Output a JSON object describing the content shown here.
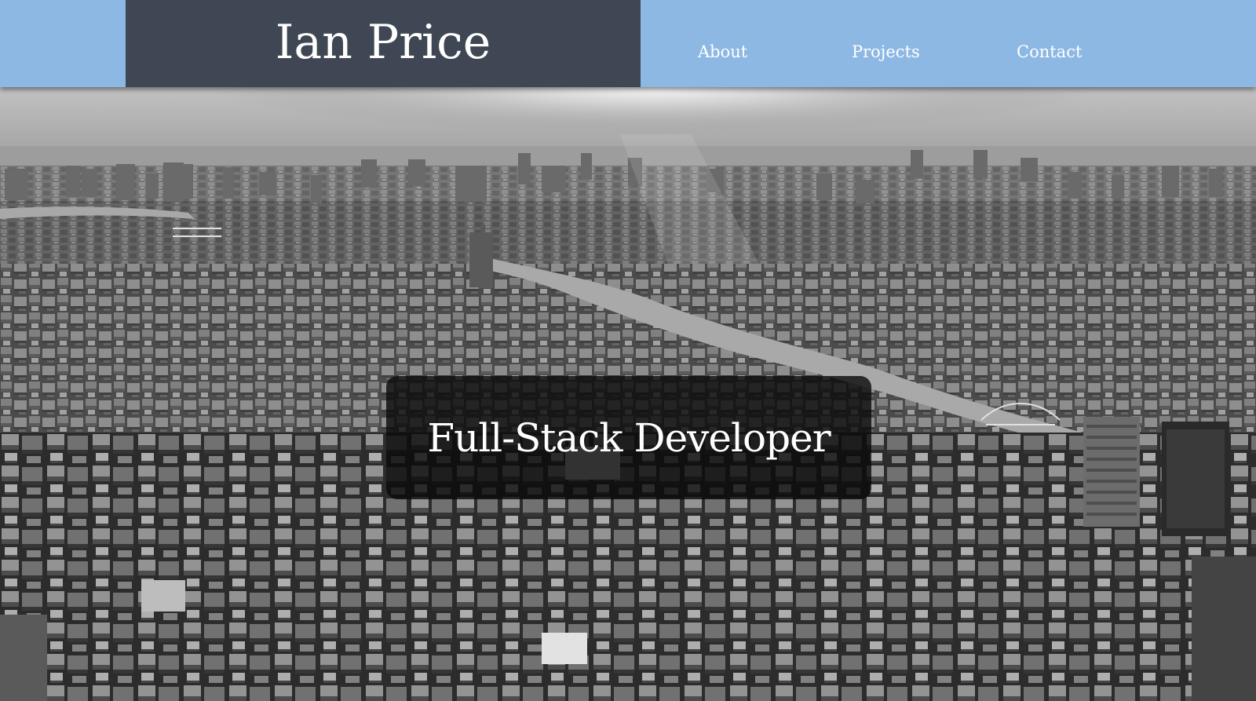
{
  "header": {
    "brand": "Ian Price",
    "nav": [
      {
        "label": "About"
      },
      {
        "label": "Projects"
      },
      {
        "label": "Contact"
      }
    ]
  },
  "hero": {
    "tagline": "Full-Stack Developer"
  },
  "colors": {
    "header_background": "#8db8e4",
    "brand_background": "#3f4754",
    "nav_text": "#ffffff",
    "tagline_box": "#0a0a0a"
  }
}
